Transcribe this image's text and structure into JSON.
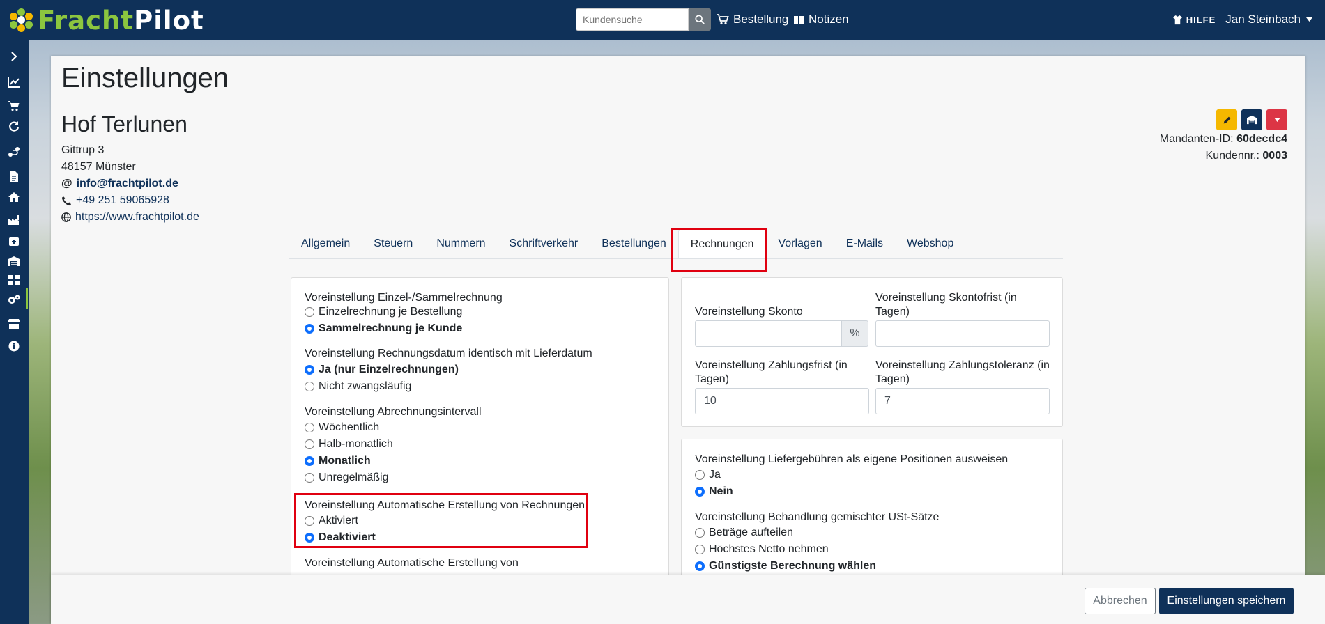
{
  "brand": {
    "part1": "Fracht",
    "part2": "Pilot"
  },
  "header": {
    "search_placeholder": "Kundensuche",
    "nav_order": "Bestellung",
    "nav_notes": "Notizen",
    "help": "HILFE",
    "user": "Jan Steinbach"
  },
  "page": {
    "title": "Einstellungen"
  },
  "company": {
    "name": "Hof Terlunen",
    "street": "Gittrup 3",
    "city": "48157 Münster",
    "email": "info@frachtpilot.de",
    "phone": "+49 251 59065928",
    "website": "https://www.frachtpilot.de",
    "mandant_label": "Mandanten-ID:",
    "mandant_id": "60decdc4",
    "kunden_label": "Kundennr.:",
    "kunden_nr": "0003"
  },
  "tabs": [
    "Allgemein",
    "Steuern",
    "Nummern",
    "Schriftverkehr",
    "Bestellungen",
    "Rechnungen",
    "Vorlagen",
    "E-Mails",
    "Webshop"
  ],
  "left_panel": {
    "g1_label": "Voreinstellung Einzel-/Sammelrechnung",
    "g1_opt1": "Einzelrechnung je Bestellung",
    "g1_opt2": "Sammelrechnung je Kunde",
    "g2_label": "Voreinstellung Rechnungsdatum identisch mit Lieferdatum",
    "g2_opt1": "Ja (nur Einzelrechnungen)",
    "g2_opt2": "Nicht zwangsläufig",
    "g3_label": "Voreinstellung Abrechnungsintervall",
    "g3_opt1": "Wöchentlich",
    "g3_opt2": "Halb-monatlich",
    "g3_opt3": "Monatlich",
    "g3_opt4": "Unregelmäßig",
    "g4_label": "Voreinstellung Automatische Erstellung von Rechnungen",
    "g4_opt1": "Aktiviert",
    "g4_opt2": "Deaktiviert",
    "g5_label": "Voreinstellung Automatische Erstellung von"
  },
  "right_top": {
    "skonto_label": "Voreinstellung Skonto",
    "skonto_value": "",
    "skonto_unit": "%",
    "skontofrist_label": "Voreinstellung Skontofrist (in Tagen)",
    "skontofrist_value": "",
    "zahlungsfrist_label": "Voreinstellung Zahlungsfrist (in Tagen)",
    "zahlungsfrist_value": "10",
    "toleranz_label": "Voreinstellung Zahlungstoleranz (in Tagen)",
    "toleranz_value": "7"
  },
  "right_bottom": {
    "g1_label": "Voreinstellung Liefergebühren als eigene Positionen ausweisen",
    "g1_opt1": "Ja",
    "g1_opt2": "Nein",
    "g2_label": "Voreinstellung Behandlung gemischter USt-Sätze",
    "g2_opt1": "Beträge aufteilen",
    "g2_opt2": "Höchstes Netto nehmen",
    "g2_opt3": "Günstigste Berechnung wählen"
  },
  "footer": {
    "cancel": "Abbrechen",
    "save": "Einstellungen speichern"
  },
  "colors": {
    "navy": "#0f3159",
    "green": "#8cc63f",
    "highlight": "#e00010",
    "edit": "#f5b800",
    "danger": "#dc3545"
  }
}
